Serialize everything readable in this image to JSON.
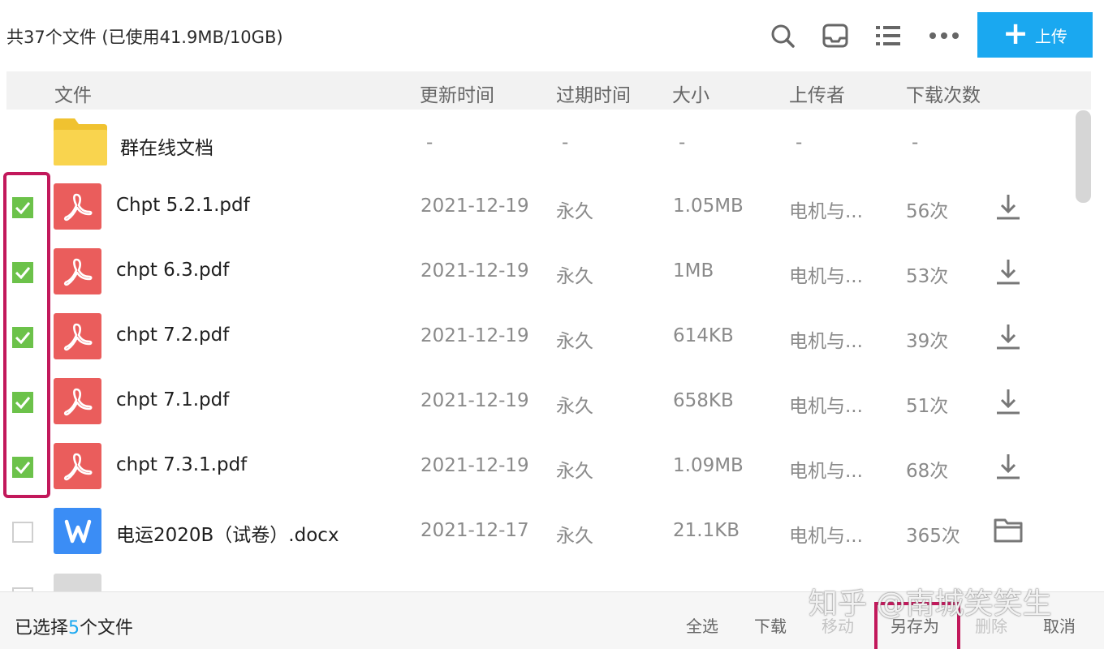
{
  "summary": "共37个文件 (已使用41.9MB/10GB)",
  "toolbar": {
    "icons": [
      "search-icon",
      "inbox-icon",
      "list-view-icon",
      "more-icon"
    ],
    "upload_plus": "+",
    "upload_label": "上传",
    "accent": "#1aa8f0"
  },
  "headers": {
    "file": "文件",
    "updated": "更新时间",
    "expires": "过期时间",
    "size": "大小",
    "uploader": "上传者",
    "downloads": "下载次数"
  },
  "folder": {
    "name": "群在线文档",
    "updated": "-",
    "expires": "-",
    "size": "-",
    "uploader": "-",
    "downloads": "-"
  },
  "rows": [
    {
      "checked": true,
      "type": "pdf",
      "name": "Chpt 5.2.1.pdf",
      "updated": "2021-12-19",
      "expires": "永久",
      "size": "1.05MB",
      "uploader": "电机与...",
      "downloads": "56次",
      "action": "download-icon"
    },
    {
      "checked": true,
      "type": "pdf",
      "name": "chpt 6.3.pdf",
      "updated": "2021-12-19",
      "expires": "永久",
      "size": "1MB",
      "uploader": "电机与...",
      "downloads": "53次",
      "action": "download-icon"
    },
    {
      "checked": true,
      "type": "pdf",
      "name": "chpt 7.2.pdf",
      "updated": "2021-12-19",
      "expires": "永久",
      "size": "614KB",
      "uploader": "电机与...",
      "downloads": "39次",
      "action": "download-icon"
    },
    {
      "checked": true,
      "type": "pdf",
      "name": "chpt 7.1.pdf",
      "updated": "2021-12-19",
      "expires": "永久",
      "size": "658KB",
      "uploader": "电机与...",
      "downloads": "51次",
      "action": "download-icon"
    },
    {
      "checked": true,
      "type": "pdf",
      "name": "chpt 7.3.1.pdf",
      "updated": "2021-12-19",
      "expires": "永久",
      "size": "1.09MB",
      "uploader": "电机与...",
      "downloads": "68次",
      "action": "download-icon"
    },
    {
      "checked": false,
      "type": "docx",
      "name": "电运2020B（试卷）.docx",
      "updated": "2021-12-17",
      "expires": "永久",
      "size": "21.1KB",
      "uploader": "电机与...",
      "downloads": "365次",
      "action": "open-folder-icon"
    }
  ],
  "footer": {
    "selected_prefix": "已选择",
    "selected_count": "5",
    "selected_suffix": "个文件",
    "select_all": "全选",
    "download": "下载",
    "move": "移动",
    "save_as": "另存为",
    "delete": "删除",
    "cancel": "取消"
  },
  "watermark": "知乎 @南城笑笑生",
  "colors": {
    "check_green": "#6cc24a",
    "pdf_red": "#ea5d5c",
    "doc_blue": "#3b8df5",
    "folder_yellow": "#f9d44e",
    "annotation": "#c2185b"
  }
}
